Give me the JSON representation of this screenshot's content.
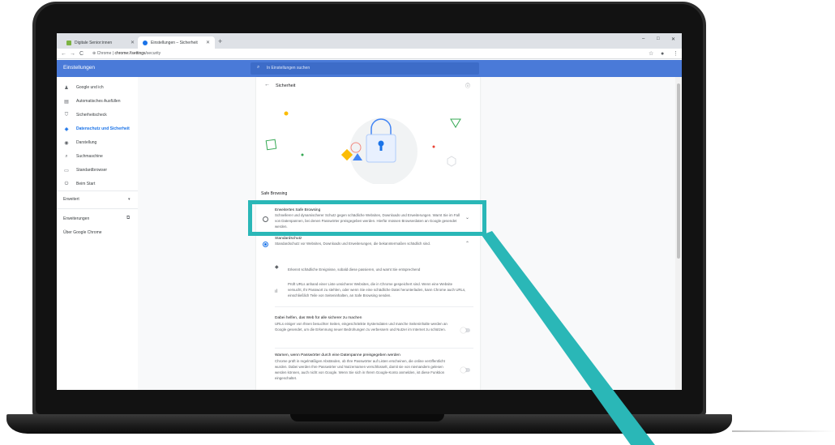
{
  "colors": {
    "accent": "#1a73e8",
    "appbar": "#4a7ad8",
    "highlight": "#2ab7b7"
  },
  "browser": {
    "tabs": [
      {
        "title": "Digitale Senior:innen",
        "active": false,
        "close": "✕"
      },
      {
        "title": "Einstellungen – Sicherheit",
        "active": true,
        "close": "✕"
      }
    ],
    "new_tab": "+",
    "window_controls": [
      "–",
      "□",
      "✕"
    ],
    "url_prefix": "Chrome",
    "url_host": "chrome://",
    "url_path": "settings",
    "url_rest": "/security"
  },
  "header": {
    "title": "Einstellungen",
    "search_placeholder": "In Einstellungen suchen"
  },
  "sidebar": {
    "items": [
      {
        "label": "Google und ich",
        "icon": "person-icon"
      },
      {
        "label": "Automatisches Ausfüllen",
        "icon": "clipboard-icon"
      },
      {
        "label": "Sicherheitscheck",
        "icon": "shield-icon"
      },
      {
        "label": "Datenschutz und Sicherheit",
        "icon": "shield-lock-icon",
        "selected": true
      },
      {
        "label": "Darstellung",
        "icon": "palette-icon"
      },
      {
        "label": "Suchmaschine",
        "icon": "search-icon"
      },
      {
        "label": "Standardbrowser",
        "icon": "browser-icon"
      },
      {
        "label": "Beim Start",
        "icon": "power-icon"
      }
    ],
    "advanced": "Erweitert",
    "extensions": "Erweiterungen",
    "about": "Über Google Chrome"
  },
  "page": {
    "title": "Sicherheit",
    "section": "Safe Browsing",
    "options": [
      {
        "title": "Erweitertes Safe Browsing",
        "desc": "Schnellerer und dynamischerer Schutz gegen schädliche Websites, Downloads und Erweiterungen. Warnt Sie im Fall von Datenpannen, bei denen Passwörter preisgegeben werden. Hierfür müssen Browserdaten an Google gesendet werden.",
        "selected": false
      },
      {
        "title": "Standardschutz",
        "desc": "Standardschutz vor Websites, Downloads und Erweiterungen, die bekanntermaßen schädlich sind.",
        "selected": true
      }
    ],
    "bullets": [
      "Erkennt schädliche Ereignisse, sobald diese passieren, und warnt Sie entsprechend",
      "Prüft URLs anhand einer Liste unsicherer Websites, die in Chrome gespeichert sind. Wenn eine Website versucht, Ihr Passwort zu stehlen, oder wenn Sie eine schädliche Datei herunterladen, kann Chrome auch URLs, einschließlich Teile von Seiteninhalten, an Safe Browsing senden."
    ],
    "toggles": [
      {
        "title": "Dabei helfen, das Web für alle sicherer zu machen",
        "desc": "URLs einiger von Ihnen besuchter Seiten, eingeschränkte Systemdaten und manche Seiteninhalte werden an Google gesendet, um die Erkennung neuer Bedrohungen zu verbessern und Nutzer im Internet zu schützen."
      },
      {
        "title": "Warnen, wenn Passwörter durch eine Datenpanne preisgegeben werden",
        "desc": "Chrome prüft in regelmäßigen Abständen, ob Ihre Passwörter auf Listen erscheinen, die online veröffentlicht wurden. Dabei werden Ihre Passwörter und Nutzernamen verschlüsselt, damit sie von niemandem gelesen werden können, auch nicht von Google. Wenn Sie sich in Ihrem Google-Konto anmelden, ist diese Funktion eingeschaltet."
      }
    ]
  }
}
